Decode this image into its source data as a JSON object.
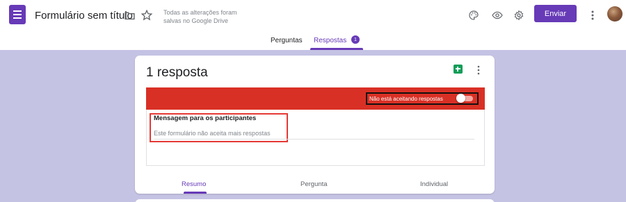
{
  "header": {
    "title": "Formulário sem título",
    "save_status": "Todas as alterações foram salvas no Google Drive",
    "send_label": "Enviar"
  },
  "tabs": {
    "questions_label": "Perguntas",
    "responses_label": "Respostas",
    "responses_badge": "1"
  },
  "summary_card": {
    "count_label": "1 resposta",
    "accepting_label": "Não está aceitando respostas",
    "message_title": "Mensagem para os participantes",
    "message_text": "Este formulário não aceita mais respostas"
  },
  "view_tabs": {
    "summary_label": "Resumo",
    "question_label": "Pergunta",
    "individual_label": "Individual"
  },
  "colors": {
    "accent": "#673ab7",
    "banner": "#d93025",
    "background": "#c5c3e4"
  },
  "icons": [
    "forms-app-icon",
    "folder-icon",
    "star-icon",
    "palette-icon",
    "eye-icon",
    "gear-icon",
    "more-vert-icon",
    "sheets-icon"
  ]
}
